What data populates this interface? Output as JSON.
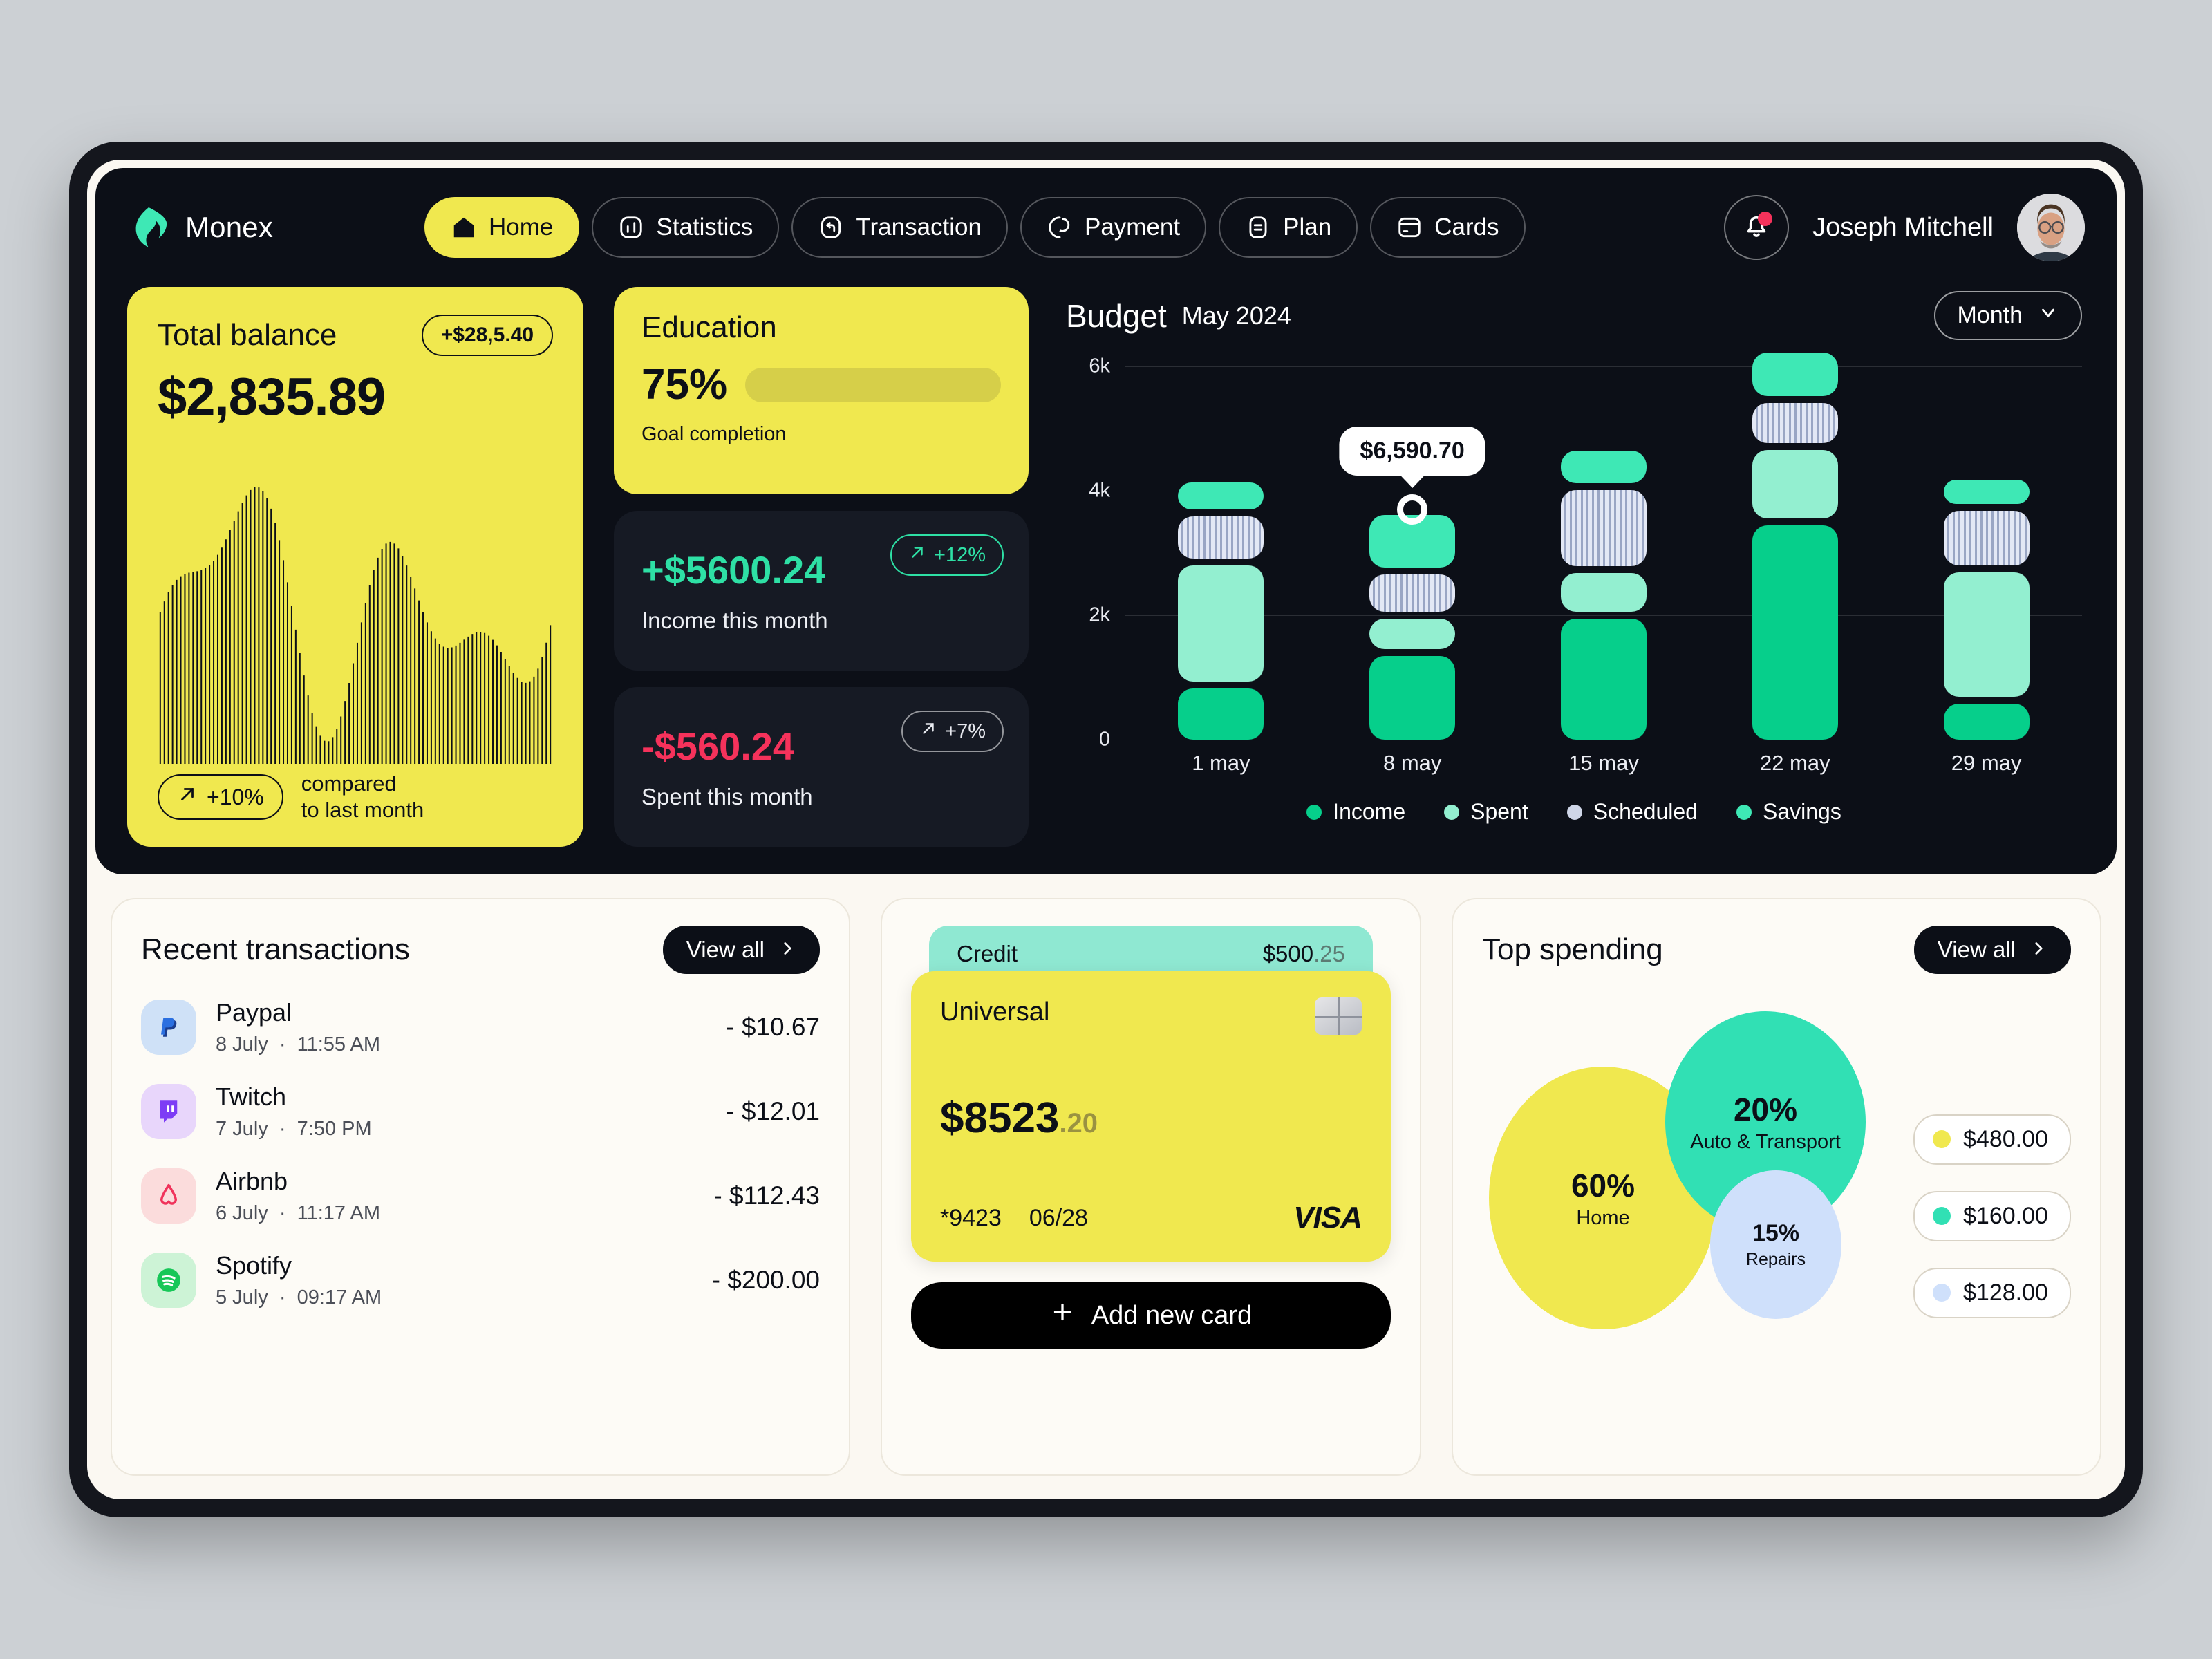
{
  "brand": {
    "name": "Monex",
    "logo_icon": "flame-logo-icon"
  },
  "nav": {
    "items": [
      {
        "label": "Home",
        "icon": "home-icon",
        "active": true
      },
      {
        "label": "Statistics",
        "icon": "bar-chart-icon",
        "active": false
      },
      {
        "label": "Transaction",
        "icon": "transaction-arrow-icon",
        "active": false
      },
      {
        "label": "Payment",
        "icon": "pie-chart-icon",
        "active": false
      },
      {
        "label": "Plan",
        "icon": "list-icon",
        "active": false
      },
      {
        "label": "Cards",
        "icon": "credit-card-icon",
        "active": false
      }
    ]
  },
  "header": {
    "notification_icon": "bell-icon",
    "has_notification": true,
    "user_name": "Joseph Mitchell",
    "avatar_icon": "user-avatar"
  },
  "balance": {
    "title": "Total balance",
    "change_badge": "+$28,5.40",
    "amount": "$2,835.89",
    "trend_icon": "arrow-up-right-icon",
    "trend": "+10%",
    "note_line1": "compared",
    "note_line2": "to last month"
  },
  "education": {
    "title": "Education",
    "percent": "75%",
    "progress": 75,
    "subtitle": "Goal completion"
  },
  "income": {
    "value": "+$5600.24",
    "label": "Income this month",
    "badge": "+12%",
    "badge_icon": "arrow-up-right-icon"
  },
  "spent": {
    "value": "-$560.24",
    "label": "Spent  this month",
    "badge": "+7%",
    "badge_icon": "arrow-up-right-icon"
  },
  "budget": {
    "title": "Budget",
    "month_label": "May 2024",
    "range_selector": "Month",
    "chevron_icon": "chevron-down-icon",
    "tooltip_value": "$6,590.70"
  },
  "chart_data": {
    "type": "bar",
    "title": "Budget",
    "subtitle": "May 2024",
    "stacked": true,
    "categories": [
      "1 may",
      "8 may",
      "15 may",
      "22 may",
      "29 may"
    ],
    "series": [
      {
        "name": "Income",
        "color": "#06cf8b",
        "values": [
          820,
          1350,
          1950,
          3450,
          580
        ]
      },
      {
        "name": "Spent",
        "color": "#93efd0",
        "values": [
          1870,
          480,
          620,
          1100,
          2000
        ]
      },
      {
        "name": "Scheduled",
        "color": "#cfd6e8",
        "values": [
          680,
          600,
          1220,
          640,
          880
        ]
      },
      {
        "name": "Savings",
        "color": "#3ee8b5",
        "values": [
          430,
          850,
          520,
          700,
          380
        ]
      }
    ],
    "ylabel": "",
    "xlabel": "",
    "ylim": [
      0,
      6000
    ],
    "yticks": [
      "0",
      "2k",
      "4k",
      "6k"
    ],
    "grid": true,
    "legend": [
      "Income",
      "Spent",
      "Scheduled",
      "Savings"
    ],
    "legend_position": "bottom",
    "annotation": {
      "label": "$6,590.70",
      "category": "8 may"
    }
  },
  "transactions": {
    "title": "Recent transactions",
    "view_all": "View all",
    "chevron_icon": "chevron-right-icon",
    "rows": [
      {
        "name": "Paypal",
        "date": "8 July",
        "time": "11:55 AM",
        "amount": "- $10.67",
        "icon": "paypal-icon",
        "bg": "#cfe1f7"
      },
      {
        "name": "Twitch",
        "date": "7 July",
        "time": "7:50 PM",
        "amount": "- $12.01",
        "icon": "twitch-icon",
        "bg": "#e8d6fb"
      },
      {
        "name": "Airbnb",
        "date": "6 July",
        "time": "11:17 AM",
        "amount": "- $112.43",
        "icon": "airbnb-icon",
        "bg": "#fbdcdc"
      },
      {
        "name": "Spotify",
        "date": "5 July",
        "time": "09:17 AM",
        "amount": "- $200.00",
        "icon": "spotify-icon",
        "bg": "#cdf3d6"
      }
    ]
  },
  "card_widget": {
    "credit_label": "Credit",
    "credit_amount_main": "$500",
    "credit_amount_cents": ".25",
    "card_name": "Universal",
    "chip_icon": "emv-chip-icon",
    "balance_main": "$8523",
    "balance_cents": ".20",
    "card_number": "*9423",
    "expiry": "06/28",
    "network": "VISA",
    "add_card_label": "Add new card",
    "plus_icon": "plus-icon"
  },
  "top_spending": {
    "title": "Top spending",
    "view_all": "View all",
    "chevron_icon": "chevron-right-icon",
    "bubbles": [
      {
        "percent": "60%",
        "label": "Home",
        "color": "#f0e84f"
      },
      {
        "percent": "20%",
        "label": "Auto & Transport",
        "color": "#31e0b4"
      },
      {
        "percent": "15%",
        "label": "Repairs",
        "color": "#cfe0fb"
      }
    ],
    "amounts": [
      {
        "value": "$480.00",
        "color": "#f0e84f"
      },
      {
        "value": "$160.00",
        "color": "#31e0b4"
      },
      {
        "value": "$128.00",
        "color": "#cfe0fb"
      }
    ]
  }
}
